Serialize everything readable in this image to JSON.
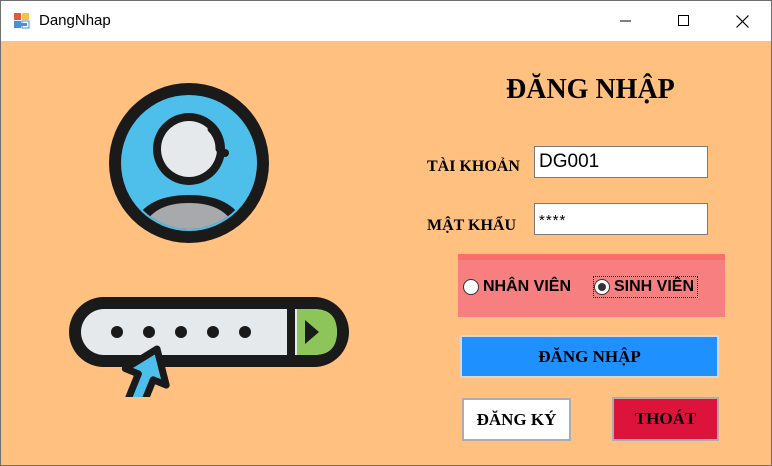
{
  "window": {
    "title": "DangNhap"
  },
  "form": {
    "heading": "ĐĂNG NHẬP",
    "username_label": "TÀI KHOẢN",
    "username_value": "DG001",
    "password_label": "MẬT KHẨU",
    "password_value": "****",
    "role_options": [
      {
        "label": "NHÂN VIÊN",
        "selected": false
      },
      {
        "label": "SINH VIÊN",
        "selected": true
      }
    ],
    "login_button": "ĐĂNG NHẬP",
    "register_button": "ĐĂNG KÝ",
    "exit_button": "THOÁT"
  },
  "colors": {
    "background": "#FFC080",
    "role_panel": "#F77F7F",
    "login_button": "#1E90FF",
    "exit_button": "#DC143C"
  },
  "icons": [
    "app-icon",
    "minimize-icon",
    "maximize-icon",
    "close-icon",
    "user-avatar-icon",
    "password-field-icon",
    "cursor-arrow-icon"
  ]
}
